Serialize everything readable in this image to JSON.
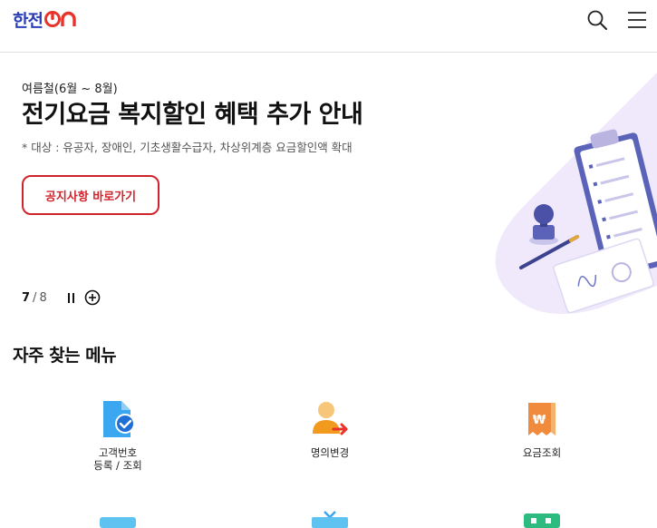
{
  "header": {
    "logo_text": "한전",
    "logo_on": "ON",
    "search_icon": "search-icon",
    "menu_icon": "hamburger-menu-icon"
  },
  "banner": {
    "eyebrow": "여름철(6월 ~ 8월)",
    "title": "전기요금 복지할인 혜택 추가 안내",
    "description": "* 대상 : 유공자, 장애인, 기초생활수급자, 차상위계층 요금할인액 확대",
    "button_label": "공지사항 바로가기",
    "pager": {
      "current": "7",
      "separator": "/",
      "total": "8"
    }
  },
  "frequent": {
    "title": "자주 찾는 메뉴",
    "items": [
      {
        "label": "고객번호\n등록 / 조회",
        "icon": "document-check-icon"
      },
      {
        "label": "명의변경",
        "icon": "person-transfer-icon"
      },
      {
        "label": "요금조회",
        "icon": "won-receipt-icon"
      }
    ]
  },
  "colors": {
    "brand_blue": "#2a3fb5",
    "brand_red": "#e8332a",
    "accent_red": "#d0242c",
    "deco_lavender": "#efe9fb"
  }
}
